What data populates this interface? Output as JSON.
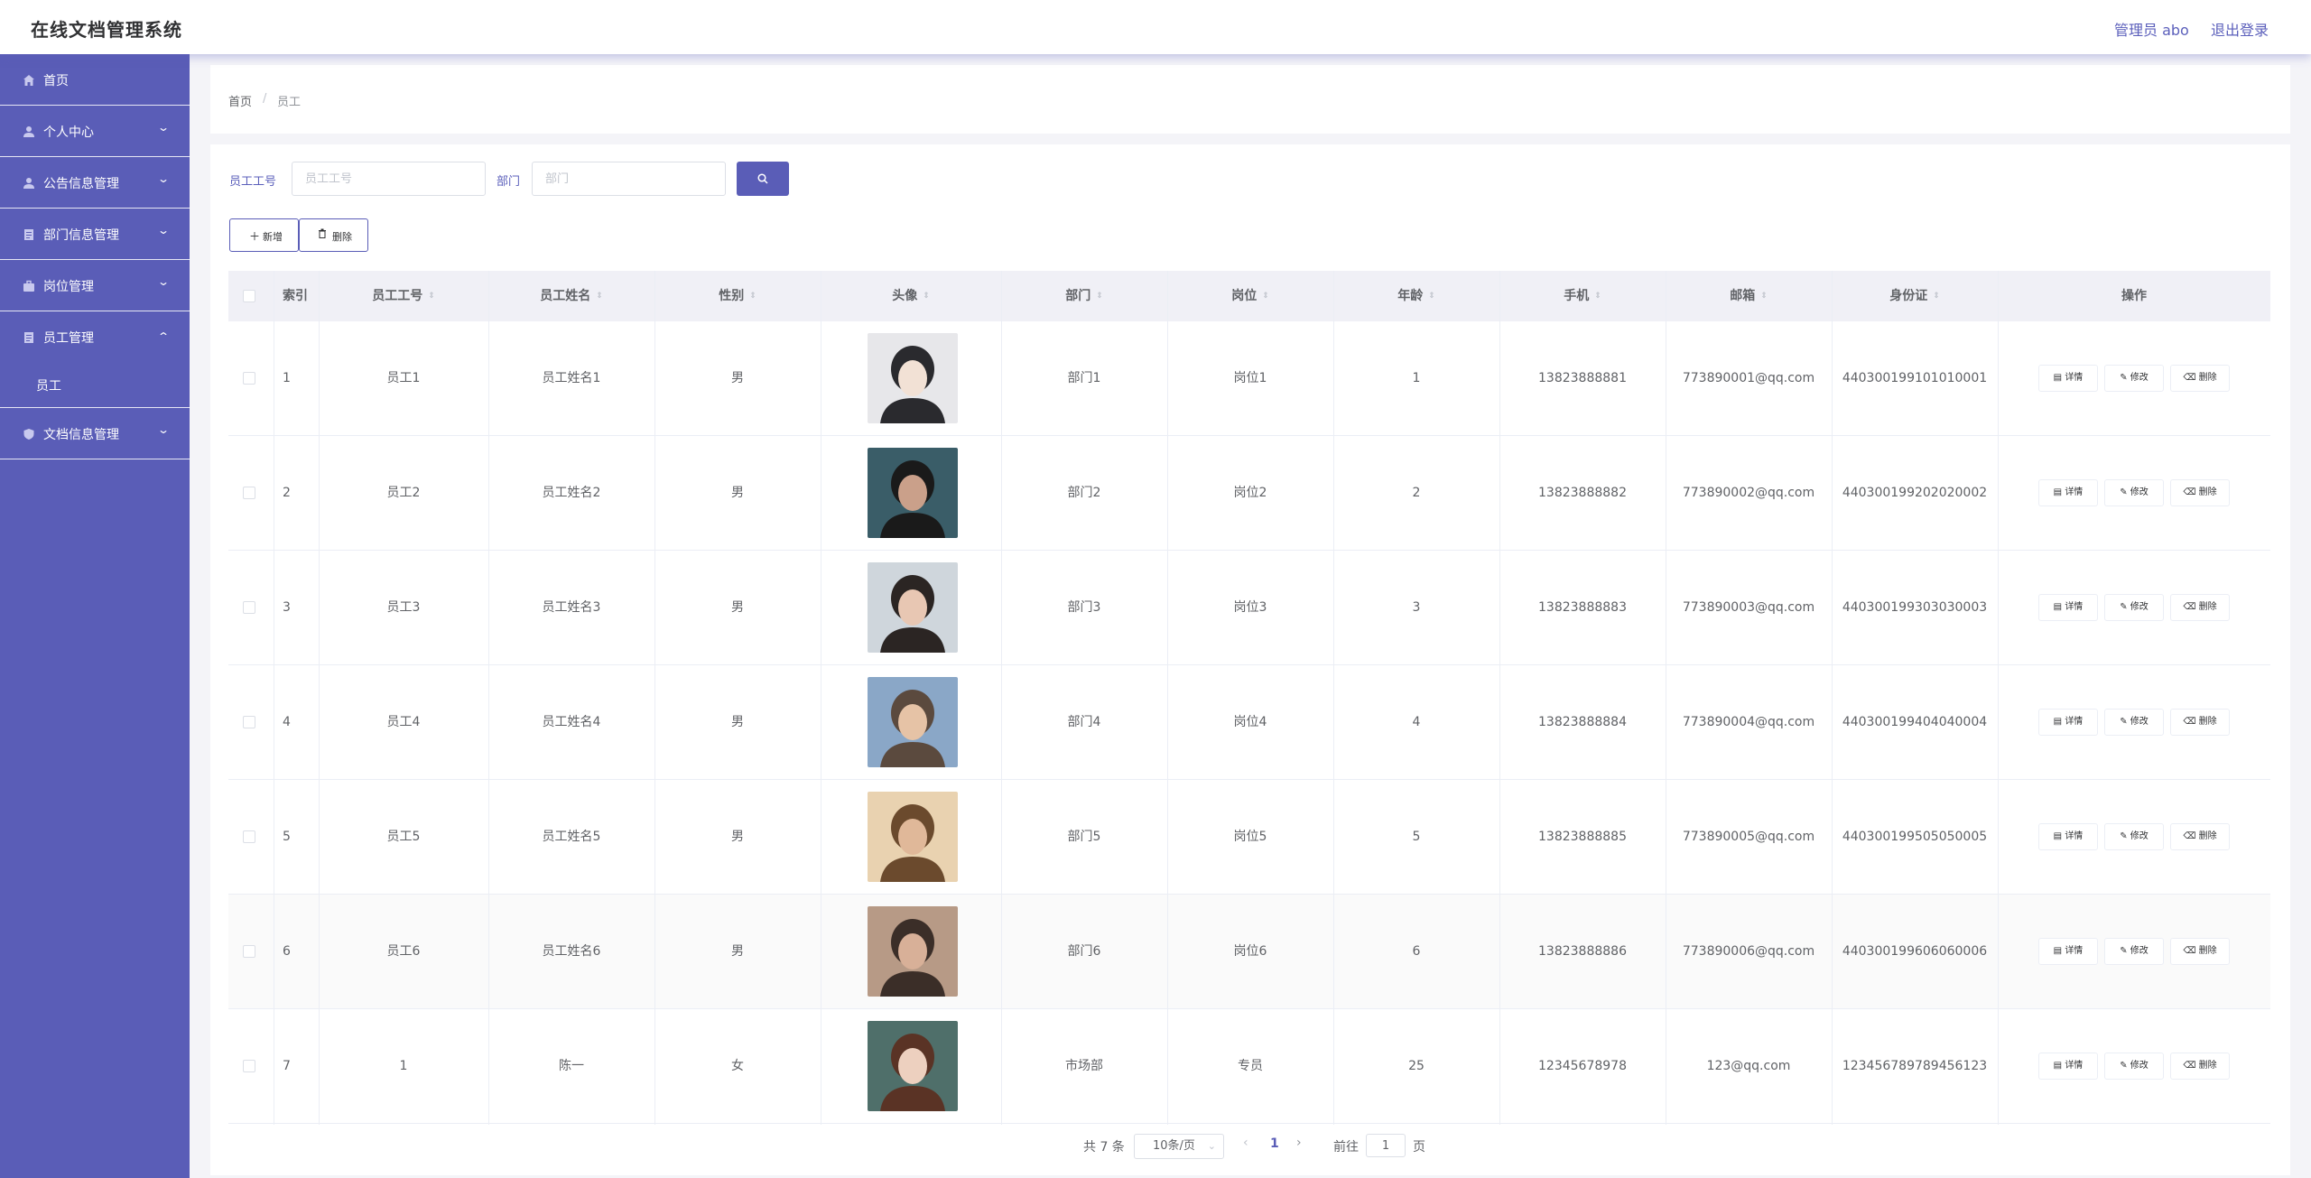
{
  "header": {
    "title": "在线文档管理系统",
    "admin_label": "管理员 abo",
    "logout_label": "退出登录"
  },
  "sidebar": {
    "items": [
      {
        "label": "首页",
        "icon": "home-icon"
      },
      {
        "label": "个人中心",
        "icon": "user-icon"
      },
      {
        "label": "公告信息管理",
        "icon": "user-icon"
      },
      {
        "label": "部门信息管理",
        "icon": "document-icon"
      },
      {
        "label": "岗位管理",
        "icon": "briefcase-icon"
      },
      {
        "label": "员工管理",
        "icon": "document-icon"
      },
      {
        "label": "文档信息管理",
        "icon": "shield-icon"
      }
    ],
    "sub_items": [
      {
        "label": "员工"
      }
    ]
  },
  "breadcrumb": {
    "home": "首页",
    "separator": "/",
    "current": "员工"
  },
  "search": {
    "employee_no_label": "员工工号",
    "employee_no_placeholder": "员工工号",
    "department_label": "部门",
    "department_placeholder": "部门"
  },
  "toolbar": {
    "add_label": "新增",
    "delete_label": "删除"
  },
  "table": {
    "columns": [
      "索引",
      "员工工号",
      "员工姓名",
      "性别",
      "头像",
      "部门",
      "岗位",
      "年龄",
      "手机",
      "邮箱",
      "身份证",
      "操作"
    ],
    "actions": {
      "detail": "详情",
      "edit": "修改",
      "delete": "删除"
    },
    "rows": [
      {
        "index": "1",
        "emp_no": "员工1",
        "name": "员工姓名1",
        "gender": "男",
        "dept": "部门1",
        "post": "岗位1",
        "age": "1",
        "phone": "13823888881",
        "email": "773890001@qq.com",
        "id_card": "440300199101010001"
      },
      {
        "index": "2",
        "emp_no": "员工2",
        "name": "员工姓名2",
        "gender": "男",
        "dept": "部门2",
        "post": "岗位2",
        "age": "2",
        "phone": "13823888882",
        "email": "773890002@qq.com",
        "id_card": "440300199202020002"
      },
      {
        "index": "3",
        "emp_no": "员工3",
        "name": "员工姓名3",
        "gender": "男",
        "dept": "部门3",
        "post": "岗位3",
        "age": "3",
        "phone": "13823888883",
        "email": "773890003@qq.com",
        "id_card": "440300199303030003"
      },
      {
        "index": "4",
        "emp_no": "员工4",
        "name": "员工姓名4",
        "gender": "男",
        "dept": "部门4",
        "post": "岗位4",
        "age": "4",
        "phone": "13823888884",
        "email": "773890004@qq.com",
        "id_card": "440300199404040004"
      },
      {
        "index": "5",
        "emp_no": "员工5",
        "name": "员工姓名5",
        "gender": "男",
        "dept": "部门5",
        "post": "岗位5",
        "age": "5",
        "phone": "13823888885",
        "email": "773890005@qq.com",
        "id_card": "440300199505050005"
      },
      {
        "index": "6",
        "emp_no": "员工6",
        "name": "员工姓名6",
        "gender": "男",
        "dept": "部门6",
        "post": "岗位6",
        "age": "6",
        "phone": "13823888886",
        "email": "773890006@qq.com",
        "id_card": "440300199606060006"
      },
      {
        "index": "7",
        "emp_no": "1",
        "name": "陈一",
        "gender": "女",
        "dept": "市场部",
        "post": "专员",
        "age": "25",
        "phone": "12345678978",
        "email": "123@qq.com",
        "id_card": "123456789789456123"
      }
    ]
  },
  "pagination": {
    "total_label": "共 7 条",
    "page_size": "10条/页",
    "current_page": "1",
    "goto_label": "前往",
    "goto_value": "1",
    "page_suffix": "页"
  },
  "colors": {
    "accent": "#5a5db7",
    "sidebar_bg": "#5a5db7",
    "link": "#5b5fbb"
  }
}
